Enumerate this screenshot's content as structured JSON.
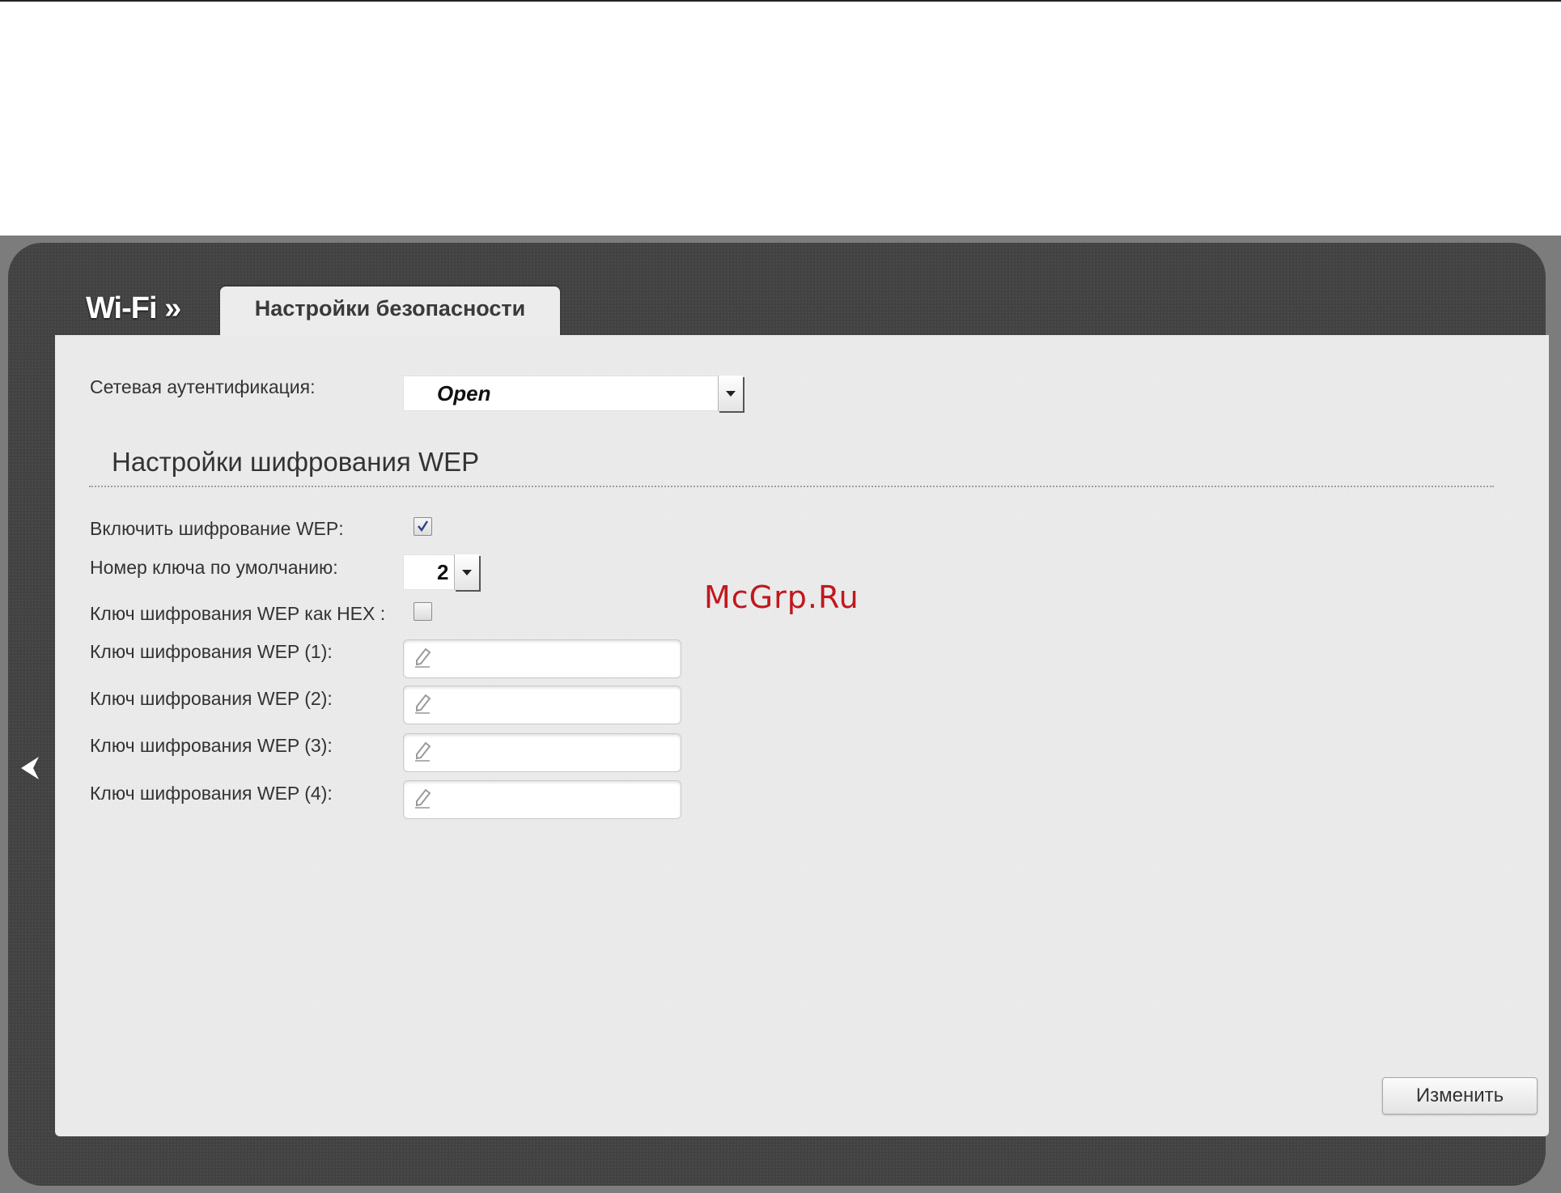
{
  "header": {
    "breadcrumb": "Wi-Fi »",
    "tab_label": "Настройки безопасности"
  },
  "auth": {
    "label": "Сетевая аутентификация:",
    "value": "Open"
  },
  "wep": {
    "section_title": "Настройки шифрования WEP",
    "enable_label": "Включить шифрование WEP:",
    "enable_checked": true,
    "default_key_label": "Номер ключа по умолчанию:",
    "default_key_value": "2",
    "hex_label": "Ключ шифрования WEP как HEX :",
    "hex_checked": false,
    "keys": [
      {
        "label": "Ключ шифрования WEP (1):",
        "value": ""
      },
      {
        "label": "Ключ шифрования WEP (2):",
        "value": ""
      },
      {
        "label": "Ключ шифрования WEP (3):",
        "value": ""
      },
      {
        "label": "Ключ шифрования WEP (4):",
        "value": ""
      }
    ]
  },
  "actions": {
    "apply_label": "Изменить"
  },
  "watermark": "McGrp.Ru",
  "icons": {
    "back": "chevron-left-icon",
    "field": "pencil-icon",
    "check": "checkmark-icon",
    "dropdown": "chevron-down-icon"
  },
  "colors": {
    "panel": "#424242",
    "content": "#ececec",
    "watermark": "#c0181e"
  }
}
